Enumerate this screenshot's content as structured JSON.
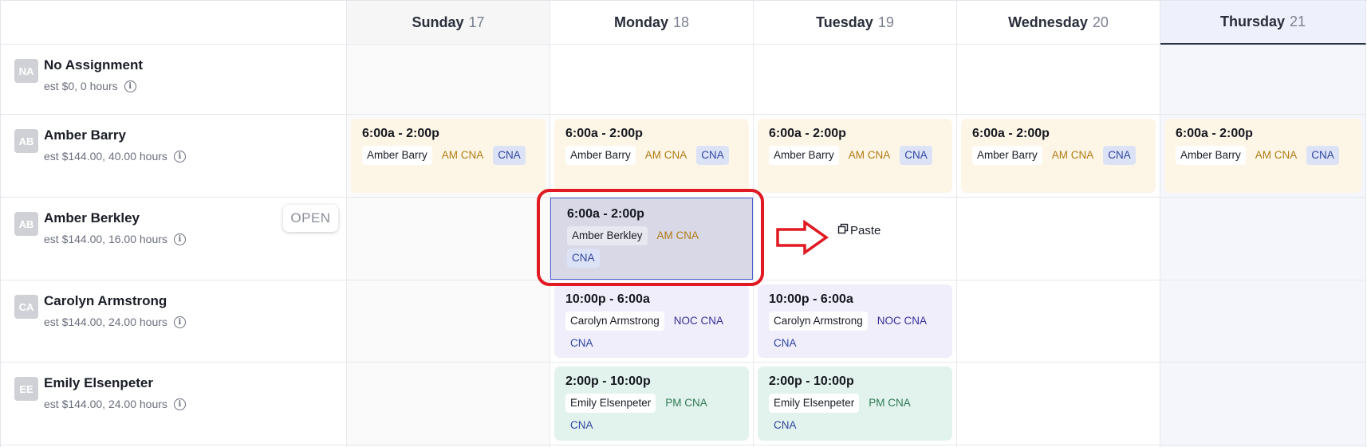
{
  "days": [
    {
      "name": "Sunday",
      "num": "17"
    },
    {
      "name": "Monday",
      "num": "18"
    },
    {
      "name": "Tuesday",
      "num": "19"
    },
    {
      "name": "Wednesday",
      "num": "20"
    },
    {
      "name": "Thursday",
      "num": "21"
    }
  ],
  "rows": [
    {
      "initials": "NA",
      "name": "No Assignment",
      "est": "est $0, 0 hours"
    },
    {
      "initials": "AB",
      "name": "Amber Barry",
      "est": "est $144.00, 40.00 hours"
    },
    {
      "initials": "AB",
      "name": "Amber Berkley",
      "est": "est $144.00, 16.00 hours",
      "open_label": "OPEN"
    },
    {
      "initials": "CA",
      "name": "Carolyn Armstrong",
      "est": "est $144.00, 24.00 hours"
    },
    {
      "initials": "EE",
      "name": "Emily Elsenpeter",
      "est": "est $144.00, 24.00 hours"
    }
  ],
  "shifts": {
    "barry": {
      "time": "6:00a - 2:00p",
      "person": "Amber Barry",
      "position": "AM CNA",
      "role": "CNA"
    },
    "berkley": {
      "time": "6:00a - 2:00p",
      "person": "Amber Berkley",
      "position": "AM CNA",
      "role": "CNA"
    },
    "armstrong": {
      "time": "10:00p - 6:00a",
      "person": "Carolyn Armstrong",
      "position": "NOC CNA",
      "role": "CNA"
    },
    "elsenpeter": {
      "time": "2:00p - 10:00p",
      "person": "Emily Elsenpeter",
      "position": "PM CNA",
      "role": "CNA"
    }
  },
  "paste_label": "Paste",
  "icons": {
    "info": "info-icon",
    "paste": "paste-icon",
    "arrow": "right-arrow-annotation"
  },
  "colors": {
    "am_shift_bg": "#fdf6e7",
    "noc_shift_bg": "#efeefa",
    "pm_shift_bg": "#e2f2ec",
    "selected_shift_bg": "#d8d8e6",
    "highlight_red": "#e01922",
    "role_tag_bg": "#dde3f6"
  }
}
